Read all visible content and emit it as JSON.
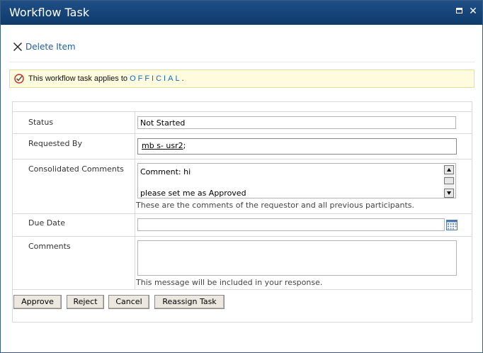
{
  "window": {
    "title": "Workflow Task"
  },
  "ribbon": {
    "delete_label": "Delete Item",
    "delete_icon": "delete-x-icon"
  },
  "notice": {
    "prefix": "This workflow task applies to ",
    "link": "OFFICIAL",
    "suffix": "."
  },
  "form": {
    "status": {
      "label": "Status",
      "value": "Not Started"
    },
    "requested_by": {
      "label": "Requested By",
      "value": "mb s- usr2",
      "suffix": ";"
    },
    "consolidated": {
      "label": "Consolidated Comments",
      "line1": "Comment: hi",
      "line2": "please set me as Approved",
      "help": "These are the comments of the requestor and all previous participants."
    },
    "due_date": {
      "label": "Due Date",
      "value": ""
    },
    "comments": {
      "label": "Comments",
      "value": "",
      "help": "This message will be included in your response."
    }
  },
  "actions": {
    "approve": "Approve",
    "reject": "Reject",
    "cancel": "Cancel",
    "reassign": "Reassign Task"
  },
  "colors": {
    "titlebar": "#0e3a6b",
    "link": "#0f6bc1",
    "notice_bg": "#fffbdf"
  }
}
